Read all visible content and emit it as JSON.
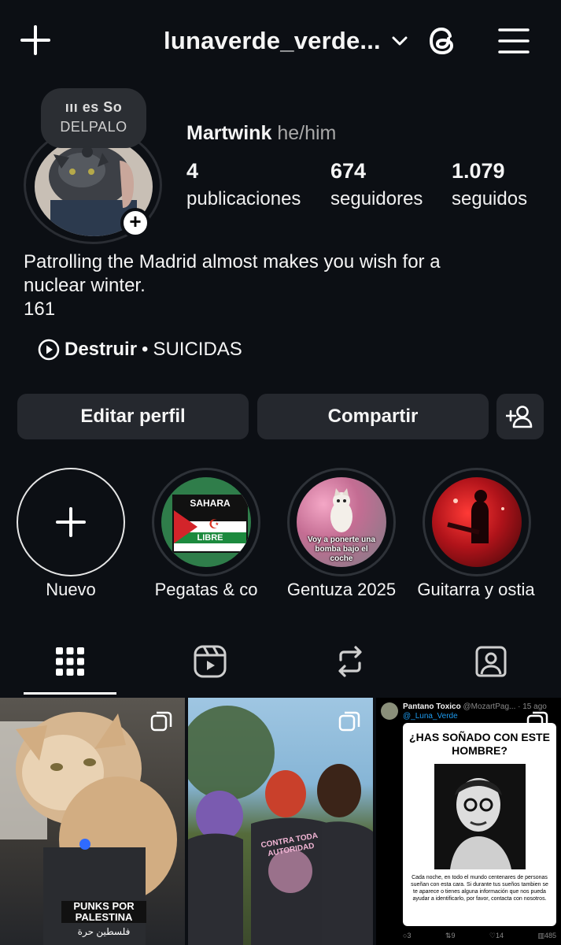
{
  "header": {
    "username": "lunaverde_verde..."
  },
  "note": {
    "line1": "ııı es   So",
    "line2": "DELPALO"
  },
  "profile": {
    "display_name": "Martwink",
    "pronouns": "he/him",
    "stats": [
      {
        "value": "4",
        "label": "publicaciones"
      },
      {
        "value": "674",
        "label": "seguidores"
      },
      {
        "value": "1.079",
        "label": "seguidos"
      }
    ],
    "bio_line1": "Patrolling the Madrid almost makes you wish for a",
    "bio_line2": "nuclear winter.",
    "bio_line3": "161",
    "music": {
      "song": "Destruir",
      "separator": "•",
      "artist": "SUICIDAS"
    }
  },
  "actions": {
    "edit": "Editar perfil",
    "share": "Compartir"
  },
  "highlights": [
    {
      "label": "Nuevo"
    },
    {
      "label": "Pegatas & co",
      "img_text_top": "SAHARA",
      "img_text_bottom": "LIBRE"
    },
    {
      "label": "Gentuza 2025",
      "img_text": "Voy a ponerte una bomba bajo el coche"
    },
    {
      "label": "Guitarra y ostia"
    }
  ],
  "posts": [
    {
      "type": "photo",
      "sticker": "PUNKS POR PALESTINA",
      "sticker_arabic": "فلسطين حرة"
    },
    {
      "type": "photo",
      "shirt_text": "CONTRA TODA AUTORIDAD"
    },
    {
      "type": "tweet",
      "author": "Pantano Toxico",
      "handle": "@MozartPag...",
      "time": "· 15 ago",
      "reply_to": "@_Luna_Verde",
      "headline": "¿HAS SOÑADO CON ESTE HOMBRE?",
      "body": "Cada noche, en todo el mundo centenares de personas sueñan con esta cara. Si durante tus sueños tambien se te aparece o tienes alguna información que nos pueda ayudar a identificarlo, por favor, contacta con nosotros.",
      "stats": [
        "3",
        "9",
        "14",
        "485"
      ]
    }
  ],
  "colors": {
    "background": "#0c0f14",
    "button": "#25282e",
    "muted_text": "#a8a8a8"
  }
}
